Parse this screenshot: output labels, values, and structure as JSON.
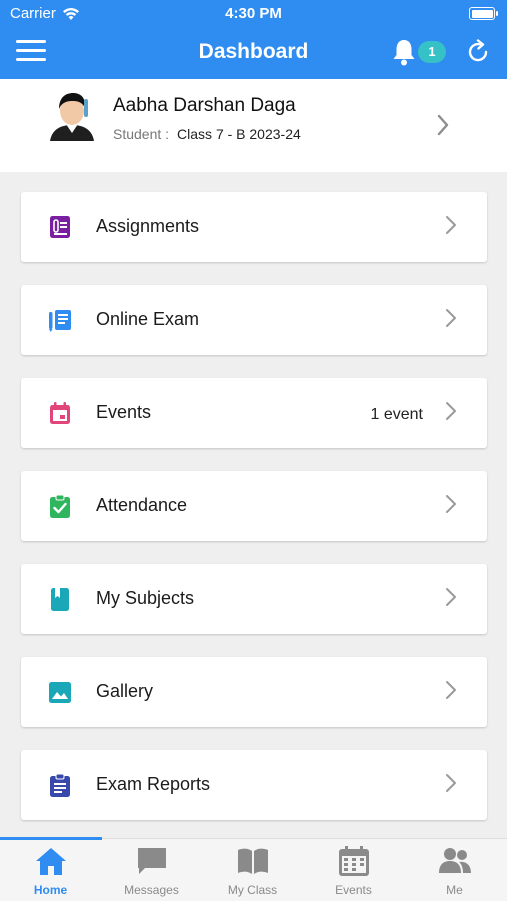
{
  "status_bar": {
    "carrier": "Carrier",
    "time": "4:30 PM",
    "battery_level": 1.0
  },
  "header": {
    "title": "Dashboard",
    "notification_count": "1"
  },
  "profile": {
    "name": "Aabha Darshan Daga",
    "role_label": "Student :",
    "class_info": "Class 7 - B 2023-24"
  },
  "menu": [
    {
      "label": "Assignments",
      "icon": "assignment-icon",
      "color": "#7b1fa2",
      "extra": ""
    },
    {
      "label": "Online Exam",
      "icon": "online-exam-icon",
      "color": "#2f8cf0",
      "extra": ""
    },
    {
      "label": "Events",
      "icon": "calendar-icon",
      "color": "#e2457a",
      "extra": "1 event"
    },
    {
      "label": "Attendance",
      "icon": "clipboard-check-icon",
      "color": "#2fb55d",
      "extra": ""
    },
    {
      "label": "My Subjects",
      "icon": "book-icon",
      "color": "#1aa7b8",
      "extra": ""
    },
    {
      "label": "Gallery",
      "icon": "image-icon",
      "color": "#1aa7b8",
      "extra": ""
    },
    {
      "label": "Exam Reports",
      "icon": "report-icon",
      "color": "#3949ab",
      "extra": ""
    }
  ],
  "tabs": [
    {
      "label": "Home",
      "icon": "home-icon",
      "active": true
    },
    {
      "label": "Messages",
      "icon": "message-icon",
      "active": false
    },
    {
      "label": "My Class",
      "icon": "open-book-icon",
      "active": false
    },
    {
      "label": "Events",
      "icon": "calendar-icon",
      "active": false
    },
    {
      "label": "Me",
      "icon": "people-icon",
      "active": false
    }
  ],
  "colors": {
    "primary": "#2f8cf0",
    "badge": "#36c1c6",
    "background": "#efefef"
  }
}
